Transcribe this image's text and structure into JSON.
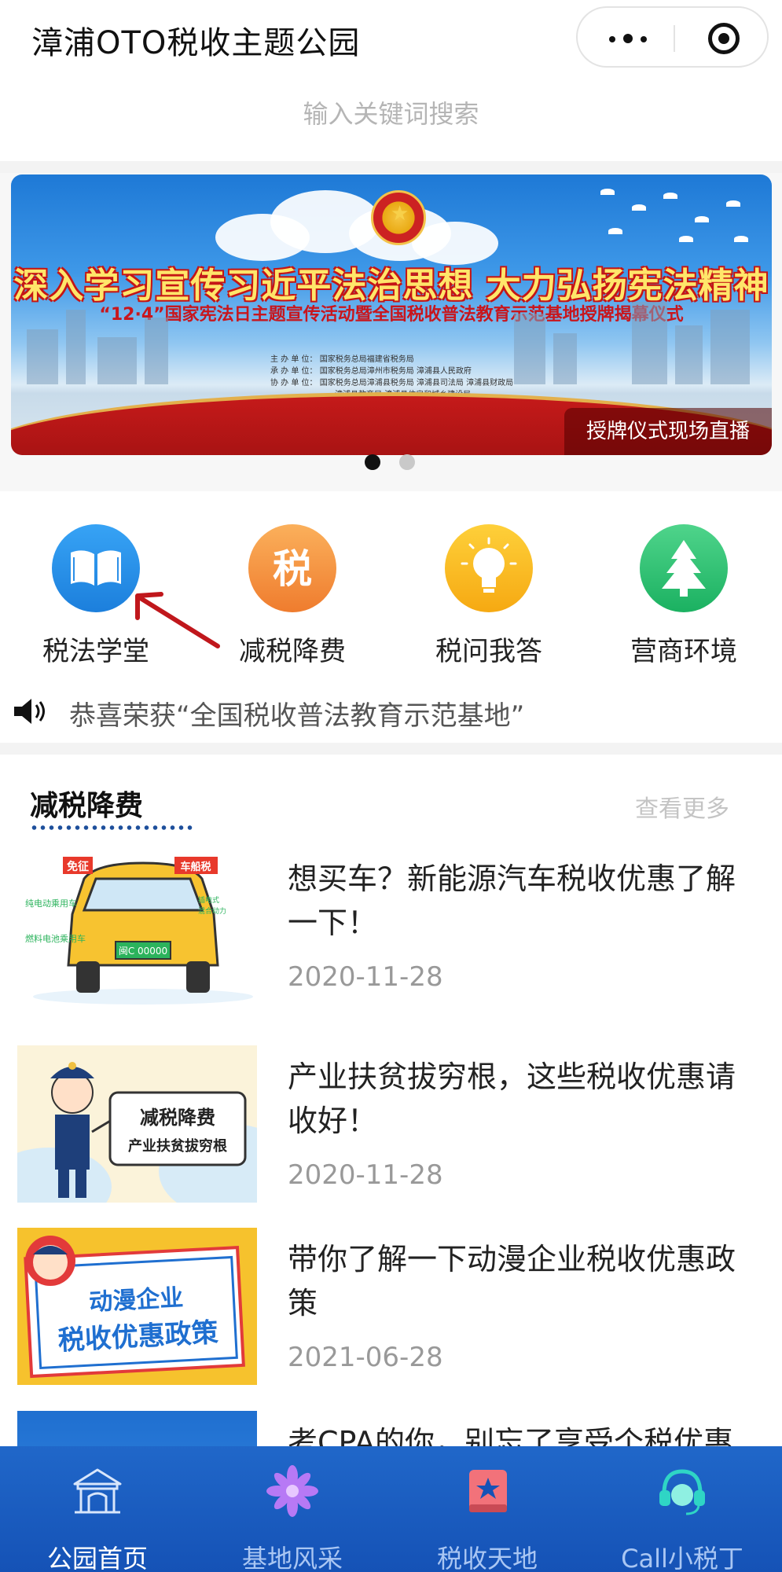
{
  "header": {
    "title": "漳浦OTO税收主题公园"
  },
  "search": {
    "placeholder": "输入关键词搜索"
  },
  "banner": {
    "headline": "深入学习宣传习近平法治思想 大力弘扬宪法精神",
    "subline": "“12·4”国家宪法日主题宣传活动暨全国税收普法教育示范基地授牌揭幕仪式",
    "credits": [
      "主 办 单 位： 国家税务总局福建省税务局",
      "承 办 单 位： 国家税务总局漳州市税务局  漳浦县人民政府",
      "协 办 单 位： 国家税务总局漳浦县税务局  漳浦县司法局  漳浦县财政局",
      "漳浦县教育局  漳浦县住房和城乡建设局"
    ],
    "live_label": "授牌仪式现场直播",
    "slide_count": 2,
    "active_slide": 1
  },
  "quick_nav": [
    {
      "label": "税法学堂",
      "icon": "book-icon"
    },
    {
      "label": "减税降费",
      "icon": "tax-icon"
    },
    {
      "label": "税问我答",
      "icon": "lightbulb-icon"
    },
    {
      "label": "营商环境",
      "icon": "tree-icon"
    }
  ],
  "notice": {
    "text": "恭喜荣获“全国税收普法教育示范基地”"
  },
  "section": {
    "title": "减税降费",
    "more": "查看更多",
    "articles": [
      {
        "title": "想买车？新能源汽车税收优惠了解一下！",
        "date": "2020-11-28",
        "thumb_text": [
          "免征",
          "车船税",
          "纯电动乘用车",
          "插电式（含增程式）混合动力汽车",
          "燃料电池乘用车",
          "闽C 00000"
        ]
      },
      {
        "title": "产业扶贫拔穷根，这些税收优惠请收好！",
        "date": "2020-11-28",
        "thumb_text": [
          "减税降费",
          "产业扶贫拔穷根"
        ]
      },
      {
        "title": "带你了解一下动漫企业税收优惠政策",
        "date": "2021-06-28",
        "thumb_text": [
          "动漫企业",
          "税收优惠政策"
        ]
      },
      {
        "title": "考CPA的你，别忘了享受个税优惠",
        "date": "",
        "thumb_text": []
      }
    ]
  },
  "tabbar": {
    "items": [
      {
        "label": "公园首页",
        "icon": "park-gate-icon",
        "active": true
      },
      {
        "label": "基地风采",
        "icon": "flower-icon",
        "active": false
      },
      {
        "label": "税收天地",
        "icon": "book-star-icon",
        "active": false
      },
      {
        "label": "Call小税丁",
        "icon": "headset-icon",
        "active": false
      }
    ]
  },
  "colors": {
    "tabbar": "#1a5cbf",
    "accent_red": "#c8161d",
    "section_underline": "#1d4f9b",
    "date_gray": "#999999"
  }
}
